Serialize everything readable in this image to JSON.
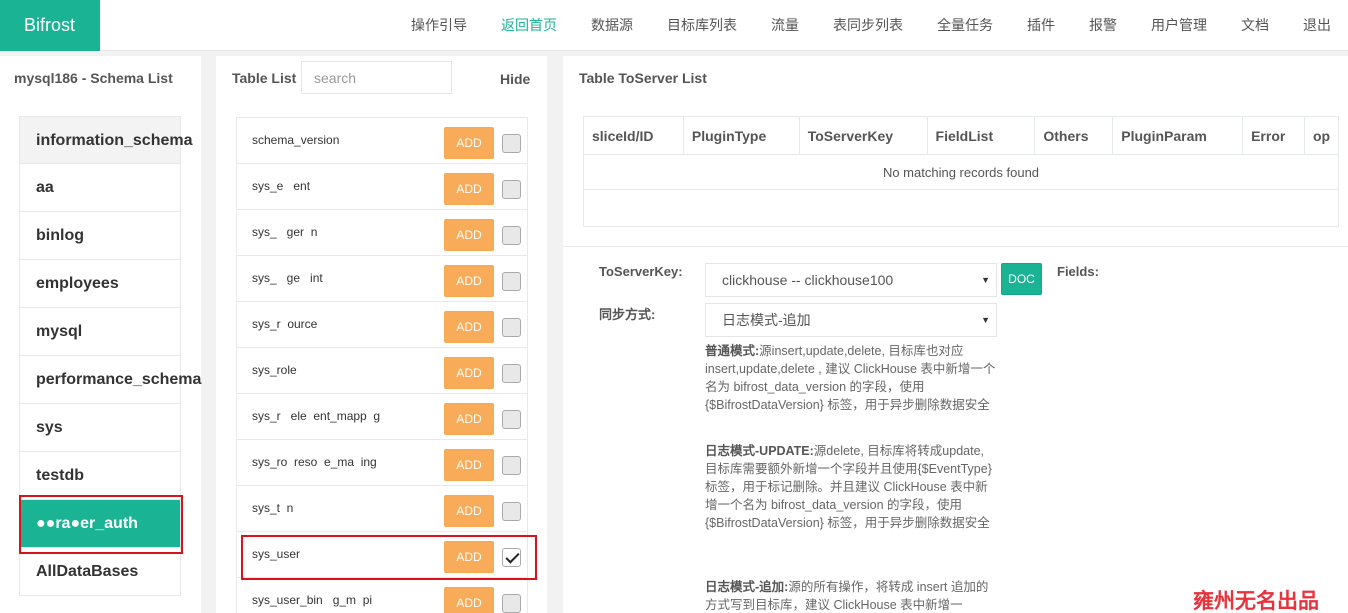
{
  "brand": "Bifrost",
  "nav": [
    "操作引导",
    "返回首页",
    "数据源",
    "目标库列表",
    "流量",
    "表同步列表",
    "全量任务",
    "插件",
    "报警",
    "用户管理",
    "文档",
    "退出"
  ],
  "nav_active_index": 1,
  "schema_panel": {
    "title": "mysql186 - Schema List",
    "items": [
      "information_schema",
      "aa",
      "binlog",
      "employees",
      "mysql",
      "performance_schema",
      "sys",
      "testdb",
      "",
      "AllDataBases"
    ],
    "selected_label": "●●ra●er_auth"
  },
  "table_panel": {
    "title": "Table List",
    "search_placeholder": "search",
    "hide_label": "Hide",
    "add_label": "ADD",
    "rows": [
      {
        "name": "schema_version",
        "checked": false
      },
      {
        "name": "sys_e   ent",
        "checked": false
      },
      {
        "name": "sys_   ger  n",
        "checked": false
      },
      {
        "name": "sys_   ge   int",
        "checked": false
      },
      {
        "name": "sys_r  ource",
        "checked": false
      },
      {
        "name": "sys_role",
        "checked": false
      },
      {
        "name": "sys_r   ele  ent_mapp  g",
        "checked": false
      },
      {
        "name": "sys_ro  reso  e_ma  ing",
        "checked": false
      },
      {
        "name": "sys_t  n",
        "checked": false
      },
      {
        "name": "sys_user",
        "checked": true
      },
      {
        "name": "sys_user_bin   g_m  pi",
        "checked": false
      }
    ]
  },
  "server_panel": {
    "title": "Table ToServer List",
    "columns": [
      "sliceId/ID",
      "PluginType",
      "ToServerKey",
      "FieldList",
      "Others",
      "PluginParam",
      "Error",
      "op"
    ],
    "empty_text": "No matching records found",
    "to_server_key_label": "ToServerKey:",
    "to_server_key_value": "clickhouse -- clickhouse100",
    "doc_label": "DOC",
    "fields_label": "Fields:",
    "sync_mode_label": "同步方式:",
    "sync_mode_value": "日志模式-追加",
    "desc1_title": "普通模式:",
    "desc1_text": "源insert,update,delete, 目标库也对应insert,update,delete , 建议 ClickHouse 表中新增一个名为 bifrost_data_version 的字段，使用 {$BifrostDataVersion} 标签，用于异步删除数据安全",
    "desc2_title": "日志模式-UPDATE:",
    "desc2_text": "源delete, 目标库将转成update, 目标库需要额外新增一个字段并且使用{$EventType}标签，用于标记删除。并且建议 ClickHouse 表中新增一个名为 bifrost_data_version 的字段，使用 {$BifrostDataVersion} 标签，用于异步删除数据安全",
    "desc3_title": "日志模式-追加:",
    "desc3_text": "源的所有操作，将转成 insert 追加的方式写到目标库，建议 ClickHouse 表中新增一"
  },
  "watermark": "雍州无名出品",
  "colors": {
    "brand": "#1ab394",
    "add_button": "#f8ac59",
    "highlight": "#d9121b",
    "watermark": "#e8323c"
  }
}
